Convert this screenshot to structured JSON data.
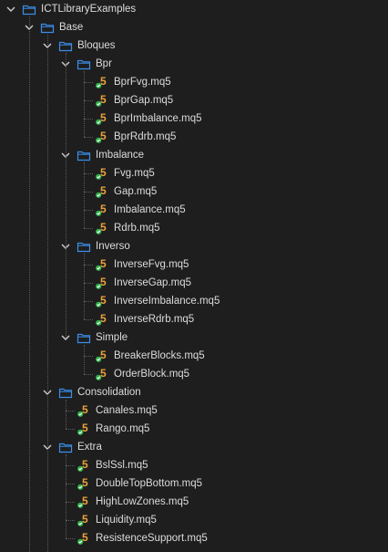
{
  "tree": [
    {
      "label": "ICTLibraryExamples",
      "type": "folder",
      "expanded": true,
      "depth": 0,
      "icon": "folder-icon"
    },
    {
      "label": "Base",
      "type": "folder",
      "expanded": true,
      "depth": 1,
      "icon": "folder-icon"
    },
    {
      "label": "Bloques",
      "type": "folder",
      "expanded": true,
      "depth": 2,
      "icon": "folder-icon"
    },
    {
      "label": "Bpr",
      "type": "folder",
      "expanded": true,
      "depth": 3,
      "icon": "folder-icon"
    },
    {
      "label": "BprFvg.mq5",
      "type": "file",
      "depth": 4,
      "icon": "mq5-file-icon"
    },
    {
      "label": "BprGap.mq5",
      "type": "file",
      "depth": 4,
      "icon": "mq5-file-icon"
    },
    {
      "label": "BprImbalance.mq5",
      "type": "file",
      "depth": 4,
      "icon": "mq5-file-icon"
    },
    {
      "label": "BprRdrb.mq5",
      "type": "file",
      "depth": 4,
      "icon": "mq5-file-icon"
    },
    {
      "label": "Imbalance",
      "type": "folder",
      "expanded": true,
      "depth": 3,
      "icon": "folder-icon"
    },
    {
      "label": "Fvg.mq5",
      "type": "file",
      "depth": 4,
      "icon": "mq5-file-icon"
    },
    {
      "label": "Gap.mq5",
      "type": "file",
      "depth": 4,
      "icon": "mq5-file-icon"
    },
    {
      "label": "Imbalance.mq5",
      "type": "file",
      "depth": 4,
      "icon": "mq5-file-icon"
    },
    {
      "label": "Rdrb.mq5",
      "type": "file",
      "depth": 4,
      "icon": "mq5-file-icon"
    },
    {
      "label": "Inverso",
      "type": "folder",
      "expanded": true,
      "depth": 3,
      "icon": "folder-icon"
    },
    {
      "label": "InverseFvg.mq5",
      "type": "file",
      "depth": 4,
      "icon": "mq5-file-icon"
    },
    {
      "label": "InverseGap.mq5",
      "type": "file",
      "depth": 4,
      "icon": "mq5-file-icon"
    },
    {
      "label": "InverseImbalance.mq5",
      "type": "file",
      "depth": 4,
      "icon": "mq5-file-icon"
    },
    {
      "label": "InverseRdrb.mq5",
      "type": "file",
      "depth": 4,
      "icon": "mq5-file-icon"
    },
    {
      "label": "Simple",
      "type": "folder",
      "expanded": true,
      "depth": 3,
      "icon": "folder-icon"
    },
    {
      "label": "BreakerBlocks.mq5",
      "type": "file",
      "depth": 4,
      "icon": "mq5-file-icon"
    },
    {
      "label": "OrderBlock.mq5",
      "type": "file",
      "depth": 4,
      "icon": "mq5-file-icon"
    },
    {
      "label": "Consolidation",
      "type": "folder",
      "expanded": true,
      "depth": 2,
      "icon": "folder-icon"
    },
    {
      "label": "Canales.mq5",
      "type": "file",
      "depth": 3,
      "icon": "mq5-file-icon"
    },
    {
      "label": "Rango.mq5",
      "type": "file",
      "depth": 3,
      "icon": "mq5-file-icon"
    },
    {
      "label": "Extra",
      "type": "folder",
      "expanded": true,
      "depth": 2,
      "icon": "folder-icon"
    },
    {
      "label": "BslSsl.mq5",
      "type": "file",
      "depth": 3,
      "icon": "mq5-file-icon"
    },
    {
      "label": "DoubleTopBottom.mq5",
      "type": "file",
      "depth": 3,
      "icon": "mq5-file-icon"
    },
    {
      "label": "HighLowZones.mq5",
      "type": "file",
      "depth": 3,
      "icon": "mq5-file-icon"
    },
    {
      "label": "Liquidity.mq5",
      "type": "file",
      "depth": 3,
      "icon": "mq5-file-icon"
    },
    {
      "label": "ResistenceSupport.mq5",
      "type": "file",
      "depth": 3,
      "icon": "mq5-file-icon"
    }
  ],
  "colors": {
    "background": "#1e1e1e",
    "text": "#dcdcdc",
    "folder_blue": "#3b8ee8",
    "mq5_orange": "#e8a13b",
    "check_green": "#2fb34a",
    "tree_lines": "#5a5a5a",
    "chevron": "#cfcfcf"
  }
}
